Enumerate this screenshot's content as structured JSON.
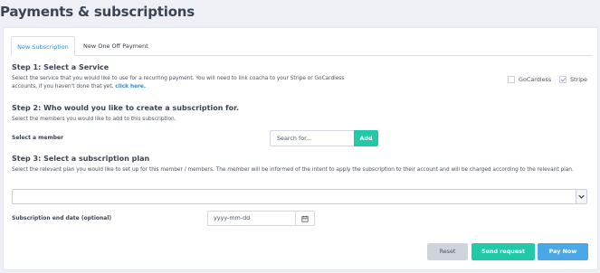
{
  "page": {
    "title": "Payments & subscriptions"
  },
  "tabs": [
    {
      "label": "New Subscription",
      "active": true
    },
    {
      "label": "New One Off Payment",
      "active": false
    }
  ],
  "step1": {
    "heading": "Step 1: Select a Service",
    "description": "Select the service that you would like to use for a recurring payment. You will need to link coacha to your Stripe or GoCardless accounts, if you haven't done that yet,",
    "link_text": "click here.",
    "options": [
      {
        "label": "GoCardless",
        "checked": false
      },
      {
        "label": "Stripe",
        "checked": true
      }
    ]
  },
  "step2": {
    "heading": "Step 2: Who would you like to create a subscription for.",
    "description": "Select the members you would like to add to this subscription.",
    "member_label": "Select a member",
    "search_placeholder": "Search for...",
    "add_label": "Add"
  },
  "step3": {
    "heading": "Step 3: Select a subscription plan",
    "description": "Select the relevant plan you would like to set up for this member / members. The member will be informed of the intent to apply the subscription to their account and will be charged according to the relevant plan.",
    "plan_value": "",
    "end_date_label": "Subscription end date (optional)",
    "end_date_placeholder": "yyyy-mm-dd"
  },
  "actions": {
    "reset_label": "Reset",
    "send_label": "Send request",
    "pay_label": "Pay Now"
  },
  "colors": {
    "accent_teal": "#22c9a9",
    "accent_blue": "#4aa8e8",
    "link_blue": "#2b8fd8",
    "background": "#eef0f6"
  }
}
